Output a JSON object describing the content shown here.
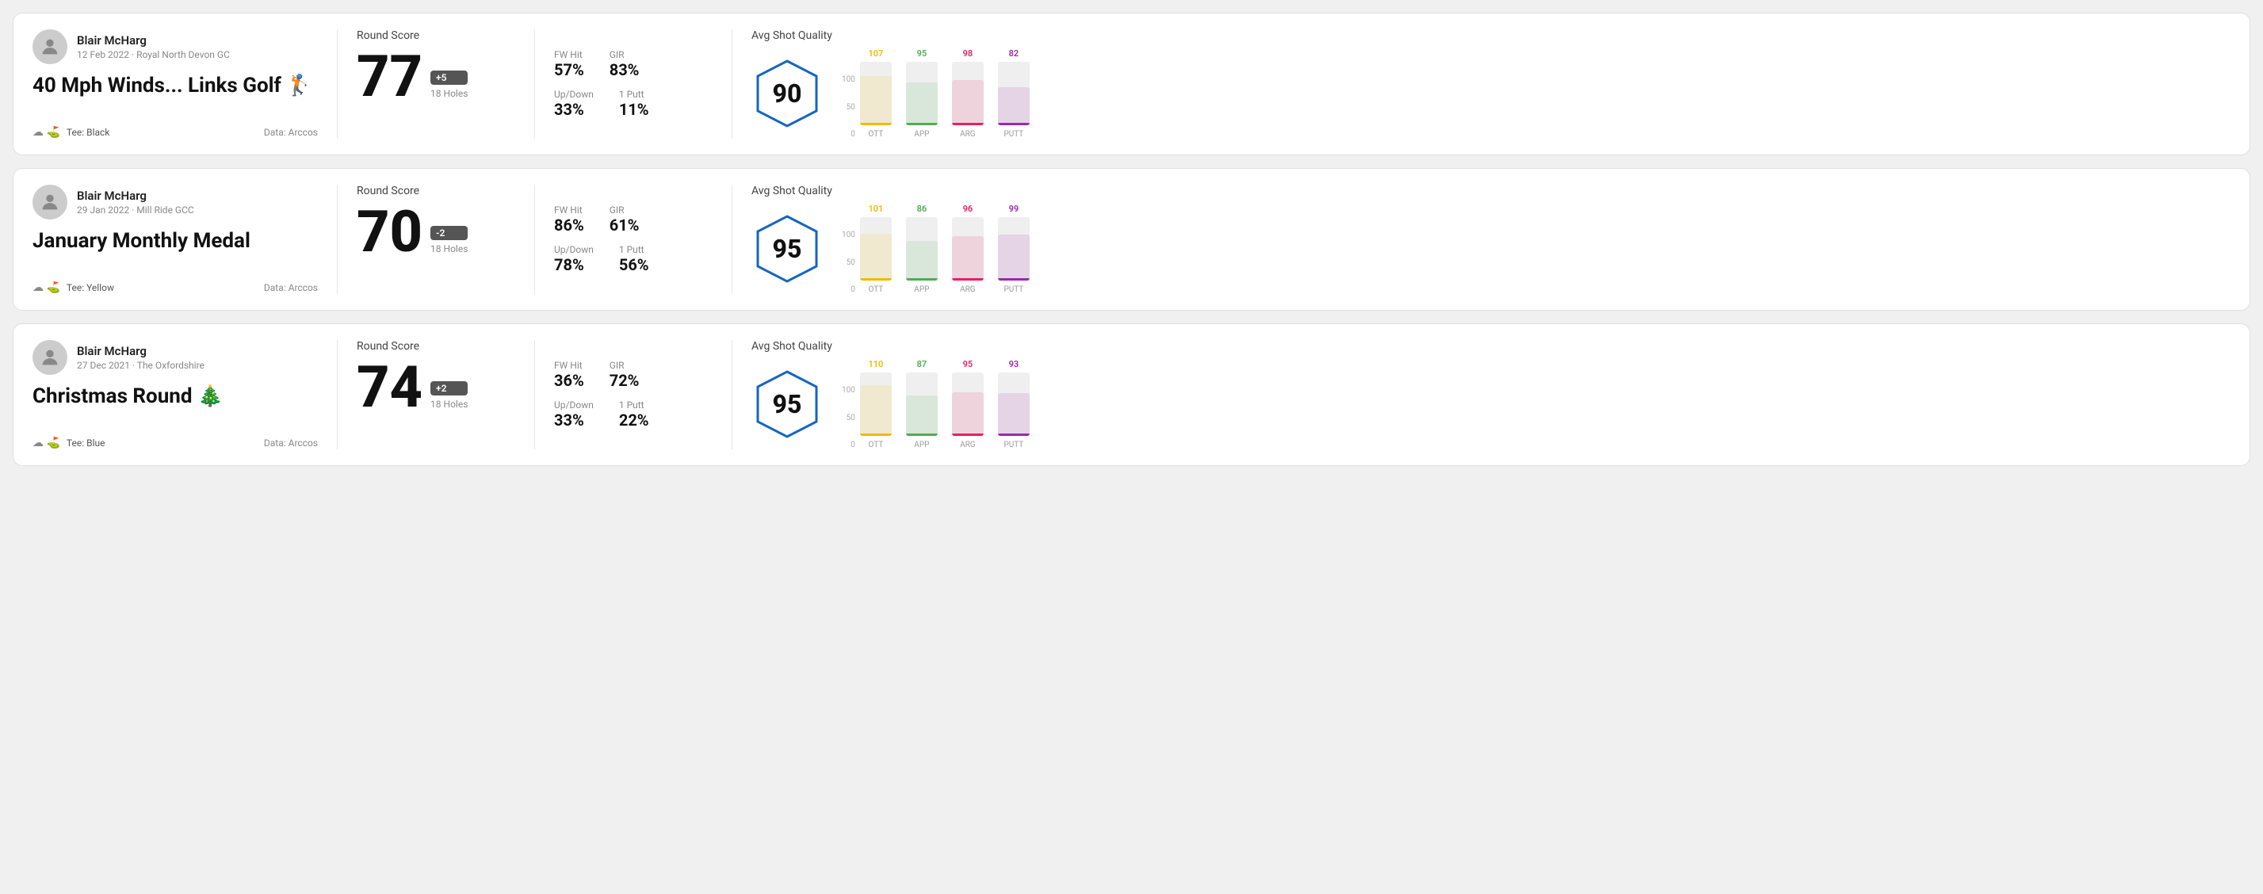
{
  "rounds": [
    {
      "id": "round-1",
      "player_name": "Blair McHarg",
      "date_course": "12 Feb 2022 · Royal North Devon GC",
      "title": "40 Mph Winds... Links Golf",
      "title_emoji": "🏌️",
      "tee": "Black",
      "data_source": "Data: Arccos",
      "score": "77",
      "score_diff": "+5",
      "holes": "18 Holes",
      "fw_hit_label": "FW Hit",
      "fw_hit": "57%",
      "gir_label": "GIR",
      "gir": "83%",
      "updown_label": "Up/Down",
      "updown": "33%",
      "oneputt_label": "1 Putt",
      "oneputt": "11%",
      "avg_quality_label": "Avg Shot Quality",
      "hex_score": "90",
      "bars": [
        {
          "label": "OTT",
          "value": 107,
          "color": "#f5b800",
          "pct": 78
        },
        {
          "label": "APP",
          "value": 95,
          "color": "#4caf50",
          "pct": 68
        },
        {
          "label": "ARG",
          "value": 98,
          "color": "#e91e63",
          "pct": 71
        },
        {
          "label": "PUTT",
          "value": 82,
          "color": "#9c27b0",
          "pct": 60
        }
      ],
      "hex_color": "#1565c0"
    },
    {
      "id": "round-2",
      "player_name": "Blair McHarg",
      "date_course": "29 Jan 2022 · Mill Ride GCC",
      "title": "January Monthly Medal",
      "title_emoji": "",
      "tee": "Yellow",
      "data_source": "Data: Arccos",
      "score": "70",
      "score_diff": "-2",
      "holes": "18 Holes",
      "fw_hit_label": "FW Hit",
      "fw_hit": "86%",
      "gir_label": "GIR",
      "gir": "61%",
      "updown_label": "Up/Down",
      "updown": "78%",
      "oneputt_label": "1 Putt",
      "oneputt": "56%",
      "avg_quality_label": "Avg Shot Quality",
      "hex_score": "95",
      "bars": [
        {
          "label": "OTT",
          "value": 101,
          "color": "#f5b800",
          "pct": 74
        },
        {
          "label": "APP",
          "value": 86,
          "color": "#4caf50",
          "pct": 63
        },
        {
          "label": "ARG",
          "value": 96,
          "color": "#e91e63",
          "pct": 70
        },
        {
          "label": "PUTT",
          "value": 99,
          "color": "#9c27b0",
          "pct": 72
        }
      ],
      "hex_color": "#1565c0"
    },
    {
      "id": "round-3",
      "player_name": "Blair McHarg",
      "date_course": "27 Dec 2021 · The Oxfordshire",
      "title": "Christmas Round",
      "title_emoji": "🎄",
      "tee": "Blue",
      "data_source": "Data: Arccos",
      "score": "74",
      "score_diff": "+2",
      "holes": "18 Holes",
      "fw_hit_label": "FW Hit",
      "fw_hit": "36%",
      "gir_label": "GIR",
      "gir": "72%",
      "updown_label": "Up/Down",
      "updown": "33%",
      "oneputt_label": "1 Putt",
      "oneputt": "22%",
      "avg_quality_label": "Avg Shot Quality",
      "hex_score": "95",
      "bars": [
        {
          "label": "OTT",
          "value": 110,
          "color": "#f5b800",
          "pct": 80
        },
        {
          "label": "APP",
          "value": 87,
          "color": "#4caf50",
          "pct": 64
        },
        {
          "label": "ARG",
          "value": 95,
          "color": "#e91e63",
          "pct": 69
        },
        {
          "label": "PUTT",
          "value": 93,
          "color": "#9c27b0",
          "pct": 68
        }
      ],
      "hex_color": "#1565c0"
    }
  ],
  "chart": {
    "y_labels": [
      "100",
      "50",
      "0"
    ]
  }
}
